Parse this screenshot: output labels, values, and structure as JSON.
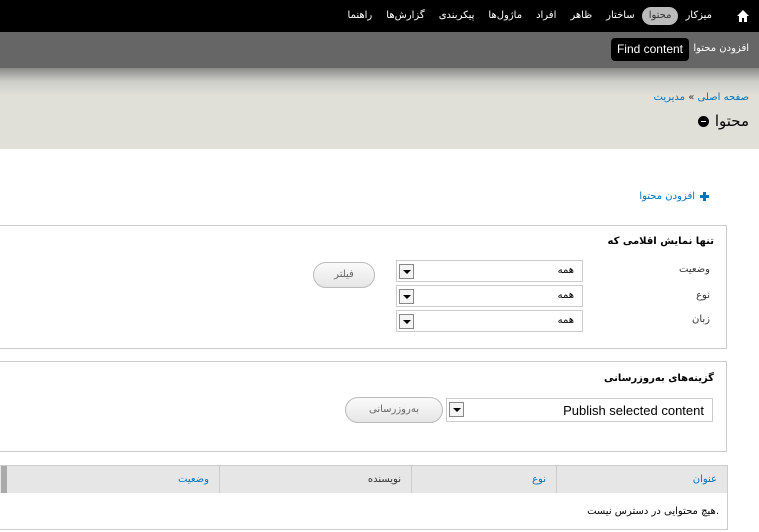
{
  "toolbar": {
    "items": [
      {
        "label": "میزکار",
        "active": false
      },
      {
        "label": "محتوا",
        "active": true
      },
      {
        "label": "ساختار",
        "active": false
      },
      {
        "label": "ظاهر",
        "active": false
      },
      {
        "label": "افراد",
        "active": false
      },
      {
        "label": "ماژول‌ها",
        "active": false
      },
      {
        "label": "پیکربندی",
        "active": false
      },
      {
        "label": "گزارش‌ها",
        "active": false
      },
      {
        "label": "راهنما",
        "active": false
      }
    ],
    "home_icon": "home-icon"
  },
  "shortcuts": {
    "add_content": "افزودن محتوا",
    "find_content": "Find content"
  },
  "header": {
    "breadcrumb_home": "صفحه اصلی",
    "breadcrumb_sep": "»",
    "breadcrumb_admin": "مدیریت",
    "title": "محتوا"
  },
  "action": {
    "add_content": "افزودن محتوا"
  },
  "filter": {
    "legend": "تنها نمایش اقلامی که",
    "status_label": "وضعیت",
    "type_label": "نوع",
    "language_label": "زبان",
    "status_value": "همه",
    "type_value": "همه",
    "language_value": "همه",
    "filter_button": "فیلتر"
  },
  "update": {
    "legend": "گزینه‌های به‌روزرسانی",
    "operation_value": "Publish selected content",
    "update_button": "به‌روزرسانی"
  },
  "table": {
    "headers": {
      "title": "عنوان",
      "type": "نوع",
      "author": "نویسنده",
      "status": "وضعیت"
    },
    "empty": "هیچ محتوایی در دسترس نیست."
  },
  "colors": {
    "link": "#0074bd",
    "toolbar": "#000000",
    "shortcuts": "#666666"
  }
}
